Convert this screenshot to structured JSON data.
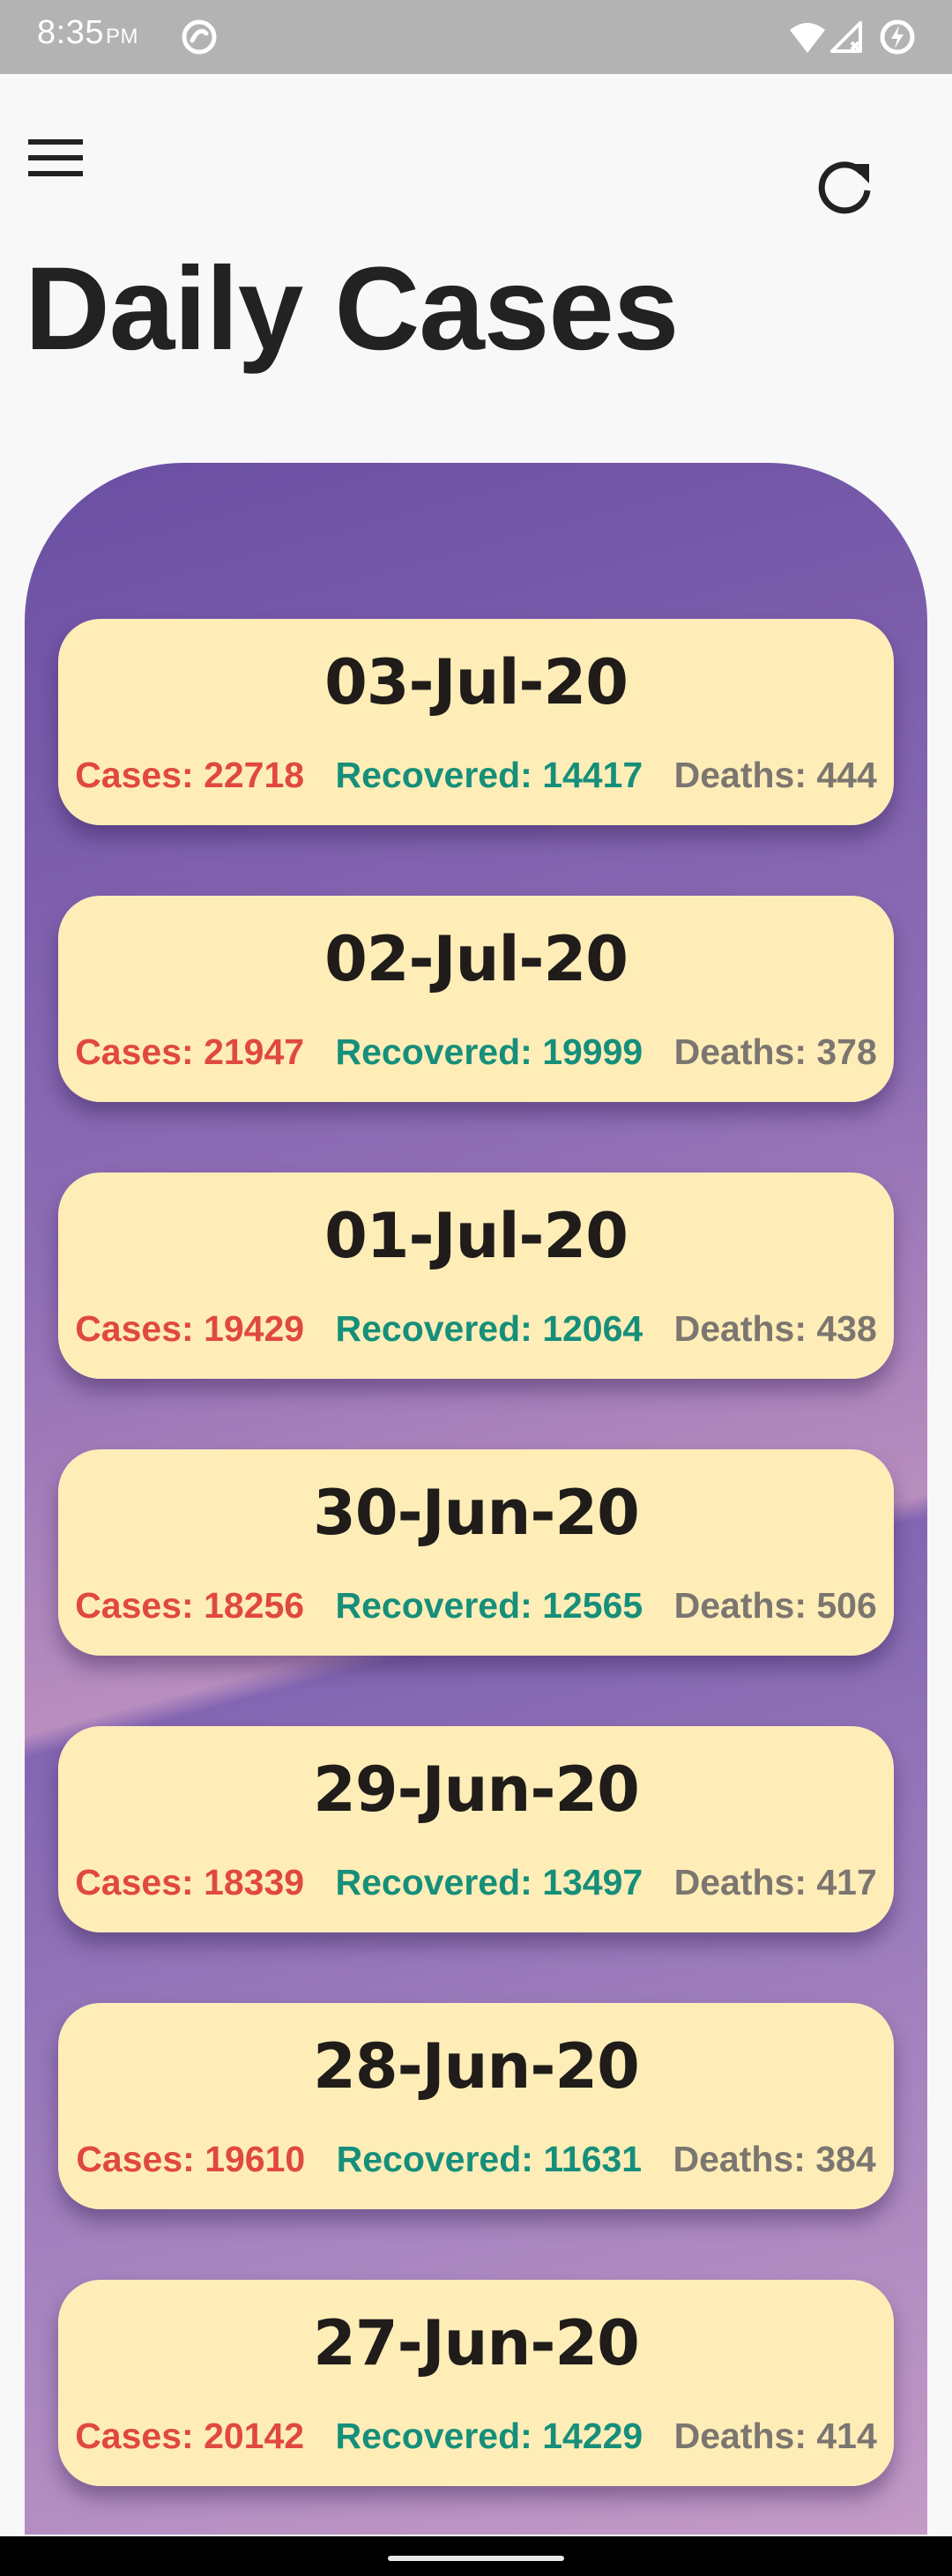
{
  "status_bar": {
    "time": "8:35",
    "ampm": "PM",
    "icons": [
      "do-not-disturb-icon",
      "wifi-icon",
      "cell-signal-icon",
      "battery-charging-icon"
    ]
  },
  "app_bar": {
    "menu_icon": "hamburger-menu-icon",
    "refresh_icon": "refresh-icon"
  },
  "page": {
    "title": "Daily Cases"
  },
  "colors": {
    "cases": "#e0493d",
    "recovered": "#168f7a",
    "deaths": "#7c7670",
    "card": "#ffedb8",
    "panel_start": "#6a4fa3",
    "panel_end": "#c49ac6"
  },
  "days": [
    {
      "date": "03-Jul-20",
      "cases": "Cases: 22718",
      "recovered": "Recovered: 14417",
      "deaths": "Deaths: 444"
    },
    {
      "date": "02-Jul-20",
      "cases": "Cases: 21947",
      "recovered": "Recovered: 19999",
      "deaths": "Deaths: 378"
    },
    {
      "date": "01-Jul-20",
      "cases": "Cases: 19429",
      "recovered": "Recovered: 12064",
      "deaths": "Deaths: 438"
    },
    {
      "date": "30-Jun-20",
      "cases": "Cases: 18256",
      "recovered": "Recovered: 12565",
      "deaths": "Deaths: 506"
    },
    {
      "date": "29-Jun-20",
      "cases": "Cases: 18339",
      "recovered": "Recovered: 13497",
      "deaths": "Deaths: 417"
    },
    {
      "date": "28-Jun-20",
      "cases": "Cases: 19610",
      "recovered": "Recovered: 11631",
      "deaths": "Deaths: 384"
    },
    {
      "date": "27-Jun-20",
      "cases": "Cases: 20142",
      "recovered": "Recovered: 14229",
      "deaths": "Deaths: 414"
    }
  ]
}
